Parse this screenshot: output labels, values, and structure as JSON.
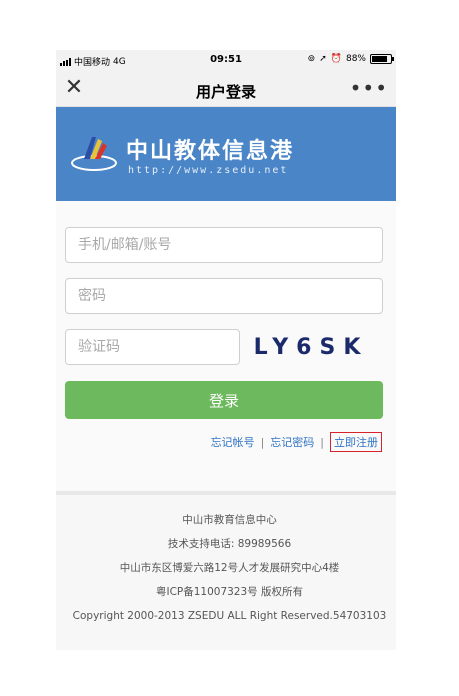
{
  "status_bar": {
    "carrier": "中国移动",
    "network": "4G",
    "time": "09:51",
    "battery": "88%"
  },
  "nav": {
    "title": "用户登录"
  },
  "banner": {
    "site_name": "中山教体信息港",
    "url": "http://www.zsedu.net"
  },
  "form": {
    "account_placeholder": "手机/邮箱/账号",
    "password_placeholder": "密码",
    "captcha_placeholder": "验证码",
    "captcha_text": "LY6SK",
    "login_label": "登录"
  },
  "links": {
    "forgot_account": "忘记帐号",
    "forgot_password": "忘记密码",
    "register": "立即注册",
    "separator": "|"
  },
  "footer": {
    "line1": "中山市教育信息中心",
    "line2": "技术支持电话: 89989566",
    "line3": "中山市东区博爱六路12号人才发展研究中心4楼",
    "line4": "粤ICP备11007323号 版权所有",
    "line5": "Copyright 2000-2013 ZSEDU ALL Right Reserved.54703103"
  },
  "colors": {
    "banner": "#4a85c7",
    "login_button": "#6dba5e",
    "link": "#2f73c4",
    "highlight_box": "#d9232a"
  }
}
